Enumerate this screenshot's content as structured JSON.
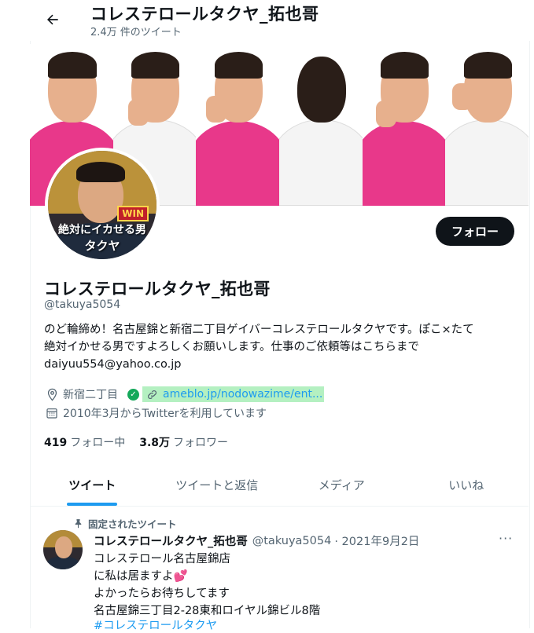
{
  "header": {
    "title": "コレステロールタクヤ_拓也哥",
    "tweet_count": "2.4万 件のツイート"
  },
  "banner": {
    "panels": [
      {
        "shirt_color": "#e8388a",
        "bg_color": "#ffffff"
      },
      {
        "shirt_color": "#ffffff",
        "bg_color": "#ffffff"
      },
      {
        "shirt_color": "#e8388a",
        "bg_color": "#ffffff"
      },
      {
        "shirt_color": "#ffffff",
        "bg_color": "#ffffff"
      },
      {
        "shirt_color": "#e8388a",
        "bg_color": "#ffffff"
      },
      {
        "shirt_color": "#ffffff",
        "bg_color": "#ffffff"
      }
    ]
  },
  "avatar": {
    "caption_line1": "絶対にイカせる男",
    "caption_line2": "タクヤ",
    "badge": "WIN"
  },
  "profile": {
    "follow_label": "フォロー",
    "name": "コレステロールタクヤ_拓也哥",
    "handle": "@takuya5054",
    "bio": "のど輪締め！名古屋錦と新宿二丁目ゲイバーコレステロールタクヤです。ぽこ×たて\n絶対イかせる男ですよろしくお願いします。仕事のご依頼等はこちらまで\ndaiyuu554@yahoo.co.jp",
    "location": "新宿二丁目",
    "link": "ameblo.jp/nodowazime/ent...",
    "joined": "2010年3月からTwitterを利用しています",
    "following_count": "419",
    "following_label": "フォロー中",
    "followers_count": "3.8万",
    "followers_label": "フォロワー"
  },
  "tabs": [
    "ツイート",
    "ツイートと返信",
    "メディア",
    "いいね"
  ],
  "pinned_tweet": {
    "pinned_label": "固定されたツイート",
    "author_name": "コレステロールタクヤ_拓也哥",
    "author_handle": "@takuya5054",
    "date": "· 2021年9月2日",
    "more": "···",
    "text": "コレステロール名古屋錦店\nに私は居ますよ💕\nよかったらお待ちしてます\n名古屋錦三丁目2-28東和ロイヤル錦ビル8階",
    "hashtag": "#コレステロールタクヤ"
  },
  "colors": {
    "accent": "#1d9bf0",
    "text": "#0f1419",
    "muted": "#536471",
    "verified": "#14a85a",
    "link_highlight": "#b4f0c1"
  }
}
